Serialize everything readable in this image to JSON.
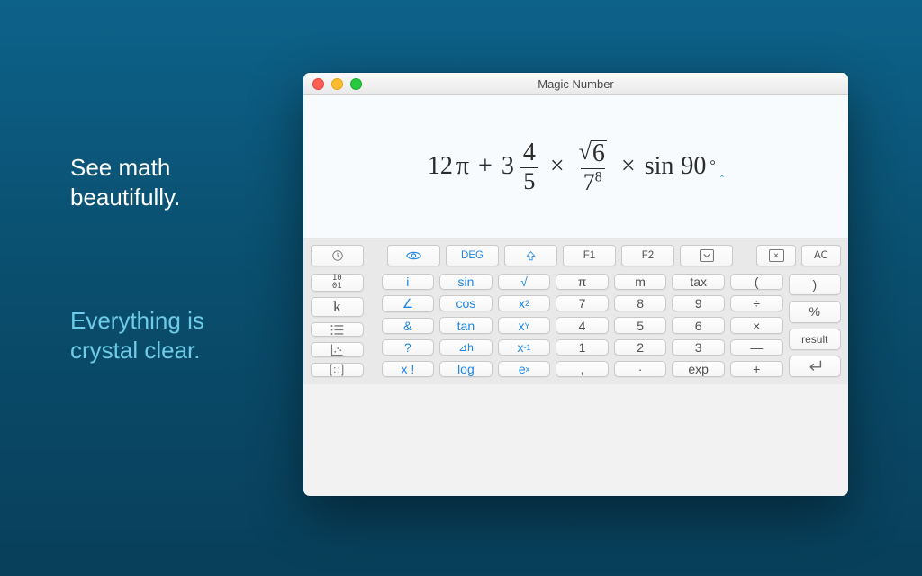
{
  "taglines": {
    "one_l1": "See math",
    "one_l2": "beautifully.",
    "two_l1": "Everything is",
    "two_l2": "crystal clear."
  },
  "window": {
    "title": "Magic Number"
  },
  "expression": {
    "coef1": "12",
    "pi": "π",
    "plus": "+",
    "mixed_whole": "3",
    "mixed_num": "4",
    "mixed_den": "5",
    "times": "×",
    "sqrt_arg": "6",
    "frac_den_base": "7",
    "frac_den_exp": "8",
    "times2": "×",
    "sin": "sin",
    "angle": "90",
    "degree": "°",
    "caret": "ˆ"
  },
  "toprow": {
    "deg": "DEG",
    "f1": "F1",
    "f2": "F2",
    "ac": "AC"
  },
  "keys": {
    "r1": {
      "bits_a": "10",
      "bits_b": "01",
      "i": "i",
      "sin": "sin",
      "sqrt": "√",
      "pi": "π",
      "m": "m",
      "tax": "tax",
      "lp": "(",
      "rp": ")"
    },
    "r2": {
      "k": "k",
      "angle": "∠",
      "cos": "cos",
      "x2_base": "x",
      "x2_sup": "2",
      "n7": "7",
      "n8": "8",
      "n9": "9",
      "div": "÷",
      "pct": "%"
    },
    "r3": {
      "amp": "&",
      "tan": "tan",
      "xy_base": "x",
      "xy_sup": "Y",
      "n4": "4",
      "n5": "5",
      "n6": "6",
      "mul": "×",
      "result": "result"
    },
    "r4": {
      "q": "?",
      "dh": "⊿h",
      "xm1_base": "x",
      "xm1_sup": "-1",
      "n1": "1",
      "n2": "2",
      "n3": "3",
      "minus": "—"
    },
    "r5": {
      "fact": "x !",
      "log": "log",
      "ex_base": "e",
      "ex_sup": "x",
      "comma": ",",
      "dot": "·",
      "exp": "exp",
      "plus": "+"
    }
  }
}
